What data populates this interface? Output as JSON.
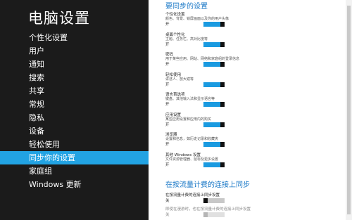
{
  "sidebar": {
    "title": "电脑设置",
    "items": [
      {
        "label": "个性化设置"
      },
      {
        "label": "用户"
      },
      {
        "label": "通知"
      },
      {
        "label": "搜索"
      },
      {
        "label": "共享"
      },
      {
        "label": "常规"
      },
      {
        "label": "隐私"
      },
      {
        "label": "设备"
      },
      {
        "label": "轻松使用"
      },
      {
        "label": "同步你的设置",
        "active": true
      },
      {
        "label": "家庭组"
      },
      {
        "label": "Windows 更新"
      }
    ]
  },
  "main": {
    "section1_title": "要同步的设置",
    "settings": [
      {
        "name": "个性化设置",
        "desc1": "颜色、背景、锁屏画面以及你的用户头像",
        "desc2": "",
        "state": "开",
        "on": true
      },
      {
        "name": "桌面个性化",
        "desc1": "主题、任务栏、高对比度等",
        "desc2": "",
        "state": "开",
        "on": true
      },
      {
        "name": "密码",
        "desc1": "用于某些应用、网站、网络和家庭组的登录信息",
        "desc2": "",
        "state": "开",
        "on": true
      },
      {
        "name": "轻松使用",
        "desc1": "讲述人、放大镜等",
        "desc2": "",
        "state": "开",
        "on": true
      },
      {
        "name": "语言首选项",
        "desc1": "键盘、其他输入法和显示语言等",
        "desc2": "",
        "state": "开",
        "on": true
      },
      {
        "name": "应用设置",
        "desc1": "某些应用设置和应用内的购买",
        "desc2": "",
        "state": "开",
        "on": true
      },
      {
        "name": "浏览器",
        "desc1": "设置和信息，如历史记录和收藏夹",
        "desc2": "",
        "state": "开",
        "on": true
      },
      {
        "name": "其他 Windows 设置",
        "desc1": "文件资源管理器、鼠标及更多设置",
        "desc2": "",
        "state": "开",
        "on": true
      }
    ],
    "section2_title": "在按流量计费的连接上同步",
    "metered": [
      {
        "name": "在按流量计费的连接上同步设置",
        "state": "关",
        "on": false,
        "disabled": false
      },
      {
        "name": "即使在漫游时，也在按流量计费的连接上同步设置",
        "state": "关",
        "on": false,
        "disabled": true
      }
    ]
  },
  "colors": {
    "sidebar_bg": "#1b1b1b",
    "accent": "#22a3e3",
    "toggle_on": "#1a9ae0",
    "section_title": "#1676c6"
  }
}
